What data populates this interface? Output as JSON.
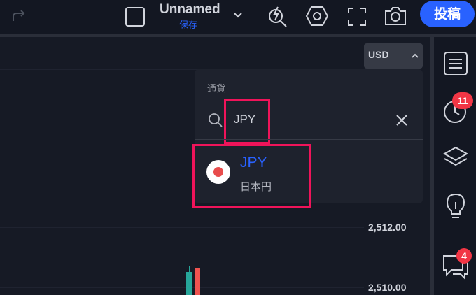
{
  "toolbar": {
    "layout_name": "Unnamed",
    "save_label": "保存",
    "publish_label": "投稿"
  },
  "chart": {
    "currency_label": "USD",
    "price_ticks": [
      "2,512.00",
      "2,510.00"
    ]
  },
  "currency_search": {
    "title": "通貨",
    "query": "JPY",
    "results": [
      {
        "code": "JPY",
        "name": "日本円"
      }
    ]
  },
  "right_sidebar": {
    "alerts_badge": "11",
    "chat_badge": "4"
  },
  "colors": {
    "accent": "#2962ff",
    "highlight": "#f0145a",
    "badge": "#f23645",
    "candle_up": "#26a69a",
    "candle_down": "#ef5350"
  }
}
